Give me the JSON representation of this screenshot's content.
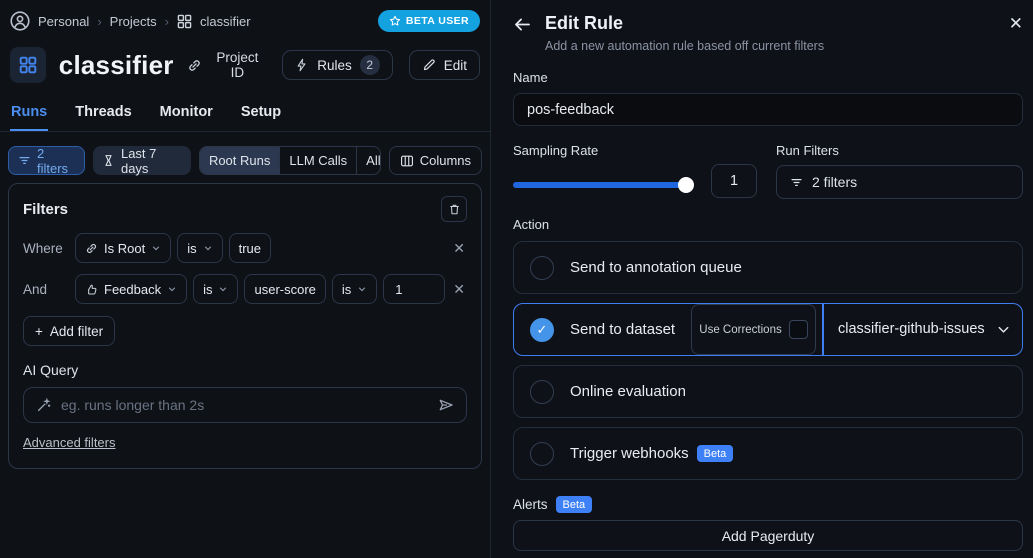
{
  "colors": {
    "accent_blue": "#4285f0",
    "beta_user_badge_bg": "#14a1e0",
    "selected_radio_blue": "#4494ea",
    "beta_badge_bg": "#3e80f6",
    "slider_track_blue": "#1f66e0"
  },
  "breadcrumb": {
    "items": [
      "Personal",
      "Projects",
      "classifier"
    ]
  },
  "beta_user": "BETA USER",
  "project": {
    "title": "classifier",
    "project_id": "Project ID",
    "rules": "Rules",
    "rules_count": "2",
    "edit": "Edit"
  },
  "tabs": [
    {
      "label": "Runs"
    },
    {
      "label": "Threads"
    },
    {
      "label": "Monitor"
    },
    {
      "label": "Setup"
    }
  ],
  "toolbar": {
    "filters": "2 filters",
    "date_range": "Last 7 days",
    "segments": [
      "Root Runs",
      "LLM Calls",
      "All Runs"
    ],
    "columns": "Columns"
  },
  "filters": {
    "title": "Filters",
    "row1": {
      "conjunction": "Where",
      "field": "Is Root",
      "op": "is",
      "value": "true"
    },
    "row2": {
      "conjunction": "And",
      "field": "Feedback",
      "op": "is",
      "key": "user-score",
      "op2": "is",
      "value": "1"
    },
    "add_filter": "Add filter",
    "ai_query_label": "AI Query",
    "ai_query_placeholder": "eg. runs longer than 2s",
    "advanced_filters": "Advanced filters"
  },
  "drawer": {
    "title": "Edit Rule",
    "subtitle": "Add a new automation rule based off current filters",
    "name_label": "Name",
    "name_value": "pos-feedback",
    "sampling_label": "Sampling Rate",
    "sampling_value": "1",
    "run_filters_label": "Run Filters",
    "run_filters_value": "2 filters",
    "action_label": "Action",
    "options": [
      {
        "label": "Send to annotation queue"
      },
      {
        "label": "Send to dataset",
        "use_corrections": "Use Corrections",
        "dataset": "classifier-github-issues"
      },
      {
        "label": "Online evaluation"
      },
      {
        "label": "Trigger webhooks",
        "badge": "Beta"
      }
    ],
    "alerts_label": "Alerts",
    "alerts_badge": "Beta",
    "add_pagerduty": "Add Pagerduty"
  }
}
